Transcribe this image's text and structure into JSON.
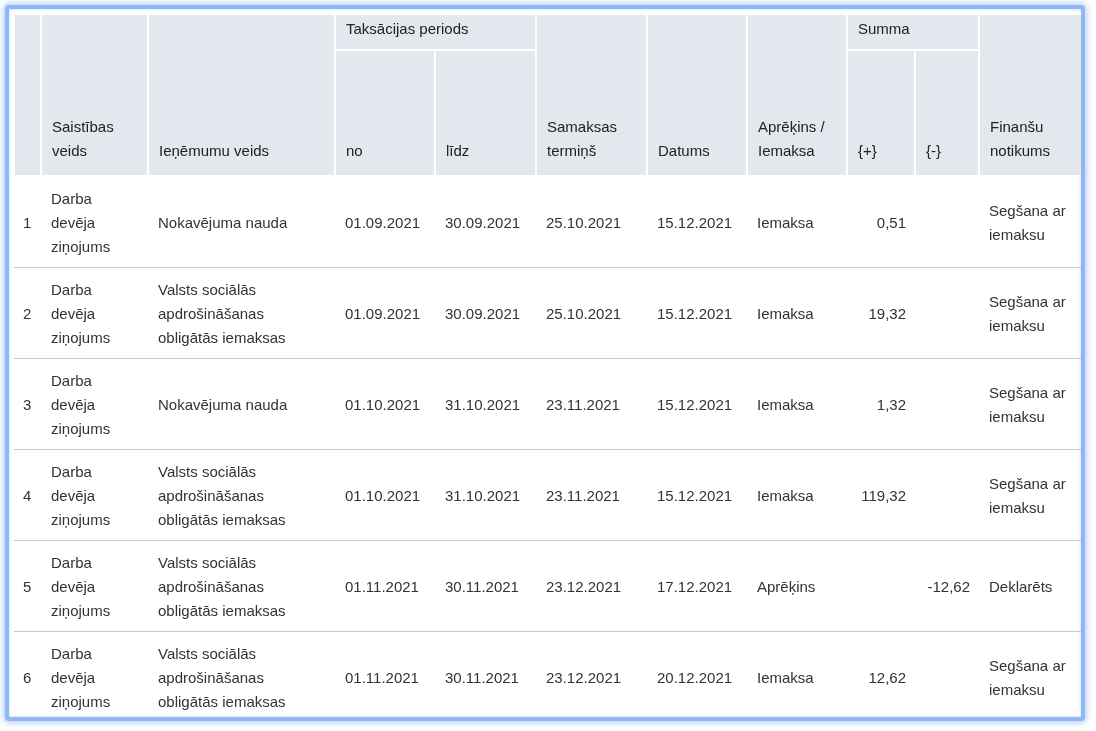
{
  "table": {
    "columns": [
      {
        "kind": "row_number"
      },
      {
        "kind": "text",
        "label": "Saistības veids"
      },
      {
        "kind": "text",
        "label": "Ieņēmumu veids"
      },
      {
        "kind": "group",
        "label": "Taksācijas periods",
        "colspan": 2,
        "children": [
          {
            "label": "no"
          },
          {
            "label": "līdz"
          }
        ]
      },
      {
        "kind": "text",
        "label": "Samaksas termiņš"
      },
      {
        "kind": "text",
        "label": "Datums"
      },
      {
        "kind": "text",
        "label": "Aprēķins / Iemaksa"
      },
      {
        "kind": "group",
        "label": "Summa",
        "colspan": 2,
        "children": [
          {
            "label": "{+}"
          },
          {
            "label": "{-}"
          }
        ]
      },
      {
        "kind": "text",
        "label": "Finanšu notikums"
      }
    ],
    "rows": [
      {
        "cells": [
          "1",
          "Darba devēja ziņojums",
          "Nokavējuma nauda",
          "01.09.2021",
          "30.09.2021",
          "25.10.2021",
          "15.12.2021",
          "Iemaksa",
          "0,51",
          null,
          "Segšana ar iemaksu"
        ]
      },
      {
        "cells": [
          "2",
          "Darba devēja ziņojums",
          "Valsts sociālās apdrošināšanas obligātās iemaksas",
          "01.09.2021",
          "30.09.2021",
          "25.10.2021",
          "15.12.2021",
          "Iemaksa",
          "19,32",
          null,
          "Segšana ar iemaksu"
        ]
      },
      {
        "cells": [
          "3",
          "Darba devēja ziņojums",
          "Nokavējuma nauda",
          "01.10.2021",
          "31.10.2021",
          "23.11.2021",
          "15.12.2021",
          "Iemaksa",
          "1,32",
          null,
          "Segšana ar iemaksu"
        ]
      },
      {
        "cells": [
          "4",
          "Darba devēja ziņojums",
          "Valsts sociālās apdrošināšanas obligātās iemaksas",
          "01.10.2021",
          "31.10.2021",
          "23.11.2021",
          "15.12.2021",
          "Iemaksa",
          "119,32",
          null,
          "Segšana ar iemaksu"
        ]
      },
      {
        "cells": [
          "5",
          "Darba devēja ziņojums",
          "Valsts sociālās apdrošināšanas obligātās iemaksas",
          "01.11.2021",
          "30.11.2021",
          "23.12.2021",
          "17.12.2021",
          "Aprēķins",
          null,
          "-12,62",
          "Deklarēts"
        ]
      },
      {
        "cells": [
          "6",
          "Darba devēja ziņojums",
          "Valsts sociālās apdrošināšanas obligātās iemaksas",
          "01.11.2021",
          "30.11.2021",
          "23.12.2021",
          "20.12.2021",
          "Iemaksa",
          "12,62",
          null,
          "Segšana ar iemaksu"
        ]
      }
    ]
  }
}
